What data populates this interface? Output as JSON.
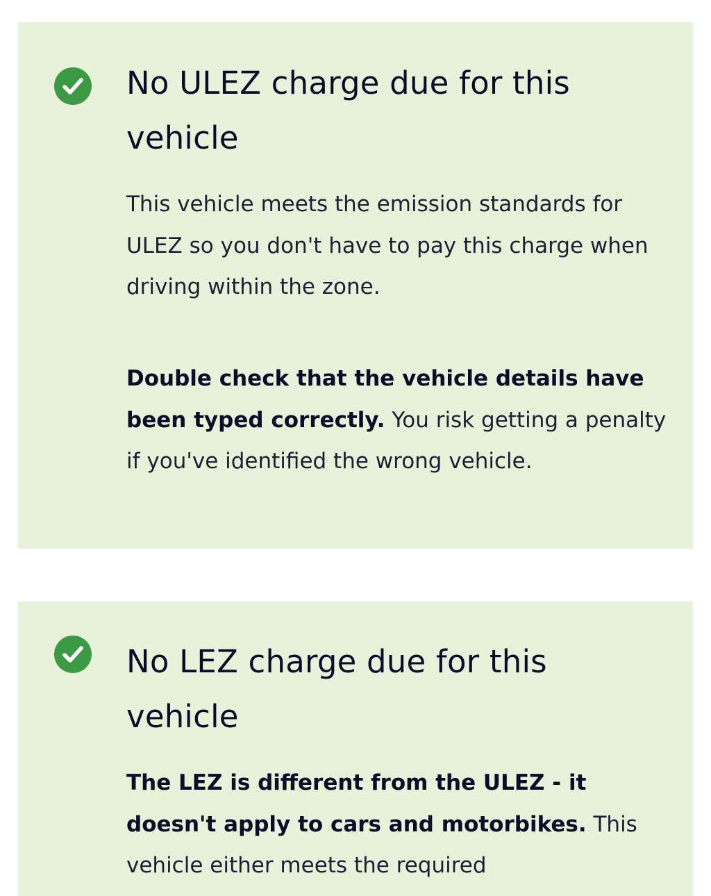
{
  "ulez_card": {
    "icon": "check-circle-icon",
    "title": "No ULEZ charge due for this vehicle",
    "description": "This vehicle meets the emission standards for ULEZ so you don't have to pay this charge when driving within the zone.",
    "warning_bold": "Double check that the vehicle details have been typed correctly.",
    "warning_rest": " You risk getting a penalty if you've identified the wrong vehicle."
  },
  "lez_card": {
    "icon": "check-circle-icon",
    "title": "No LEZ charge due for this vehicle",
    "note_bold": "The LEZ is different from the ULEZ - it doesn't apply to cars and motorbikes.",
    "note_rest": " This vehicle either meets the required"
  },
  "colors": {
    "card_background": "#e8f2da",
    "check_green": "#3c9a44",
    "text": "#0b0c28"
  }
}
